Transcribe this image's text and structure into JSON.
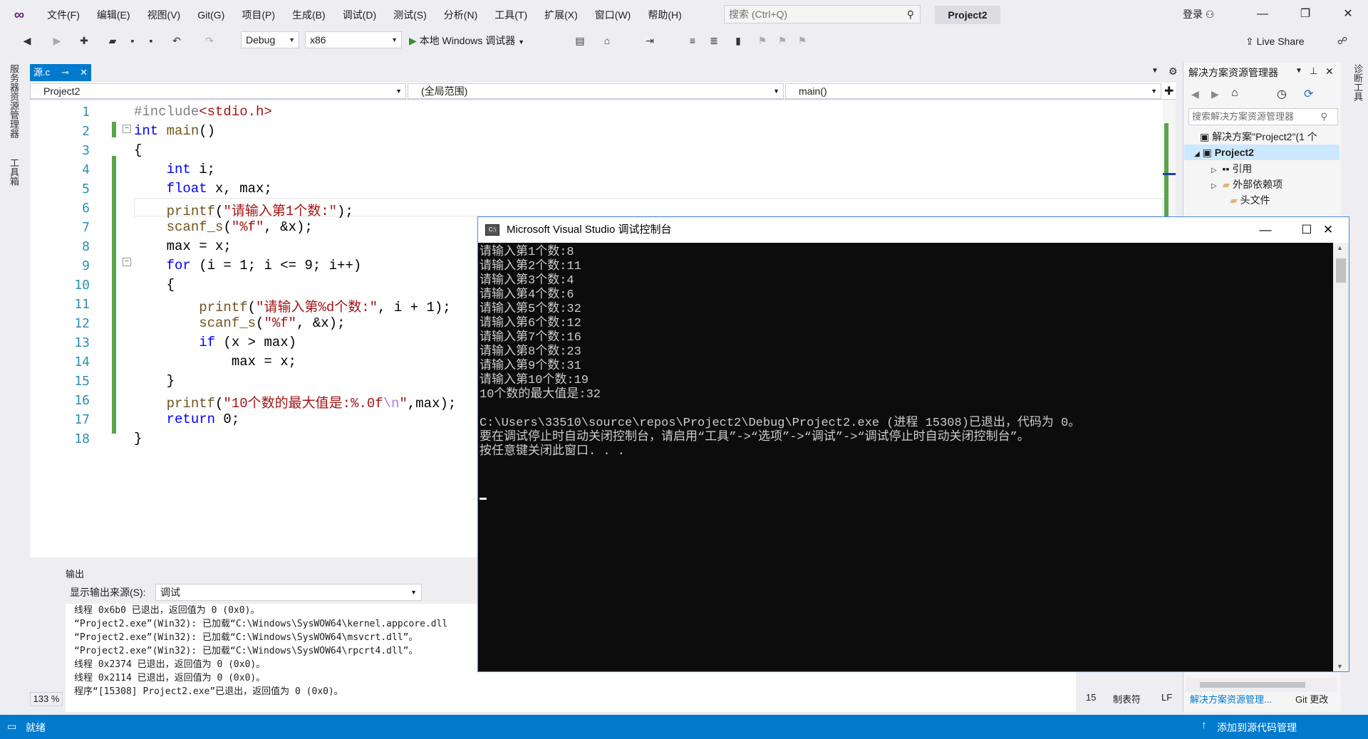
{
  "menubar": {
    "items": [
      "文件(F)",
      "编辑(E)",
      "视图(V)",
      "Git(G)",
      "项目(P)",
      "生成(B)",
      "调试(D)",
      "测试(S)",
      "分析(N)",
      "工具(T)",
      "扩展(X)",
      "窗口(W)",
      "帮助(H)"
    ],
    "search_placeholder": "搜索 (Ctrl+Q)",
    "project": "Project2",
    "login": "登录"
  },
  "toolbar": {
    "config": "Debug",
    "platform": "x86",
    "run_label": "本地 Windows 调试器",
    "live_share": "Live Share"
  },
  "leftstrip": {
    "server_explorer": "服务器资源管理器",
    "toolbox": "工具箱"
  },
  "rightstrip": {
    "diagnostics": "诊断工具"
  },
  "editor": {
    "tab_name": "源.c",
    "nav_project": "Project2",
    "nav_scope": "(全局范围)",
    "nav_func": "main()",
    "zoom": "133 %",
    "line_numbers": [
      "1",
      "2",
      "3",
      "4",
      "5",
      "6",
      "7",
      "8",
      "9",
      "10",
      "11",
      "12",
      "13",
      "14",
      "15",
      "16",
      "17",
      "18"
    ]
  },
  "output": {
    "title": "输出",
    "source_label": "显示输出来源(S):",
    "source_value": "调试",
    "lines": [
      "线程 0x6b0 已退出，返回值为 0 (0x0)。",
      "“Project2.exe”(Win32): 已加载“C:\\Windows\\SysWOW64\\kernel.appcore.dll",
      "“Project2.exe”(Win32): 已加载“C:\\Windows\\SysWOW64\\msvcrt.dll”。",
      "“Project2.exe”(Win32): 已加载“C:\\Windows\\SysWOW64\\rpcrt4.dll”。",
      "线程 0x2374 已退出，返回值为 0 (0x0)。",
      "线程 0x2114 已退出，返回值为 0 (0x0)。",
      "程序“[15308] Project2.exe”已退出，返回值为 0 (0x0)。"
    ]
  },
  "solution": {
    "title": "解决方案资源管理器",
    "search_placeholder": "搜索解决方案资源管理器",
    "solution_item": "解决方案\"Project2\"(1 个",
    "project_item": "Project2",
    "references": "引用",
    "external": "外部依赖项",
    "headers": "头文件",
    "bottom_tab": "解决方案资源管理...",
    "git_tab": "Git 更改",
    "line_col": "15",
    "tab_mode": "制表符",
    "eol": "LF"
  },
  "status": {
    "ready": "就绪",
    "add_source": "添加到源代码管理"
  },
  "console": {
    "title": "Microsoft Visual Studio 调试控制台",
    "lines": [
      "请输入第1个数:8",
      "请输入第2个数:11",
      "请输入第3个数:4",
      "请输入第4个数:6",
      "请输入第5个数:32",
      "请输入第6个数:12",
      "请输入第7个数:16",
      "请输入第8个数:23",
      "请输入第9个数:31",
      "请输入第10个数:19",
      "10个数的最大值是:32",
      "",
      "C:\\Users\\33510\\source\\repos\\Project2\\Debug\\Project2.exe (进程 15308)已退出，代码为 0。",
      "要在调试停止时自动关闭控制台，请启用“工具”->“选项”->“调试”->“调试停止时自动关闭控制台”。",
      "按任意键关闭此窗口. . ."
    ]
  },
  "colors": {
    "accent": "#007acc",
    "keyword": "#0000ff",
    "string": "#a31515",
    "change_bar": "#57a64a"
  }
}
